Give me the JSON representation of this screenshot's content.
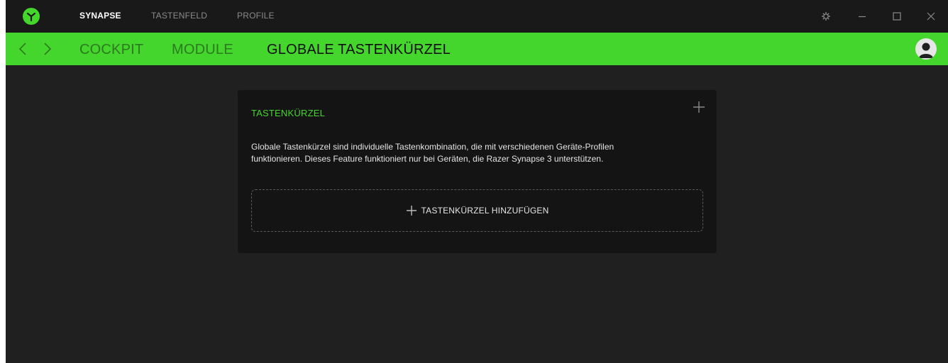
{
  "app": {
    "top_tabs": [
      {
        "label": "SYNAPSE",
        "active": true
      },
      {
        "label": "TASTENFELD",
        "active": false
      },
      {
        "label": "PROFILE",
        "active": false
      }
    ],
    "window_controls": [
      "gear-icon",
      "minimize-icon",
      "maximize-icon",
      "close-icon"
    ],
    "brand_color": "#44d62c"
  },
  "nav": {
    "back_icon": "chevron-left-icon",
    "forward_icon": "chevron-right-icon",
    "tabs": [
      {
        "label": "COCKPIT",
        "active": false
      },
      {
        "label": "MODULE",
        "active": false
      },
      {
        "label": "GLOBALE TASTENKÜRZEL",
        "active": true
      }
    ],
    "avatar_icon": "user-avatar-icon"
  },
  "card": {
    "title": "TASTENKÜRZEL",
    "description_line1": "Globale Tastenkürzel sind individuelle Tastenkombination, die mit verschiedenen Geräte-Profilen",
    "description_line2": "funktionieren. Dieses Feature funktioniert nur bei Geräten, die Razer Synapse 3 unterstützen.",
    "add_button_label": "TASTENKÜRZEL HINZUFÜGEN"
  }
}
